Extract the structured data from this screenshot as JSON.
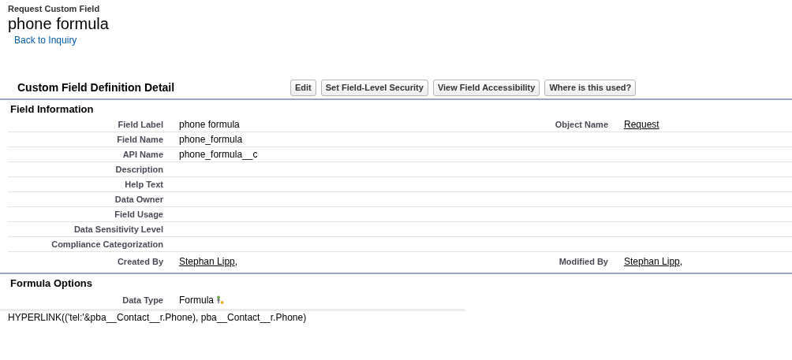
{
  "header": {
    "object": "Request Custom Field",
    "title": "phone formula",
    "back_link": "Back to Inquiry"
  },
  "detail": {
    "title": "Custom Field Definition Detail",
    "buttons": [
      "Edit",
      "Set Field-Level Security",
      "View Field Accessibility",
      "Where is this used?"
    ]
  },
  "field_information": {
    "title": "Field Information",
    "rows": [
      {
        "label": "Field Label",
        "value": "phone formula",
        "kind": "text",
        "right": {
          "label": "Object Name",
          "value": "Request",
          "kind": "link"
        }
      },
      {
        "label": "Field Name",
        "value": "phone_formula",
        "kind": "text"
      },
      {
        "label": "API Name",
        "value": "phone_formula__c",
        "kind": "text"
      },
      {
        "label": "Description"
      },
      {
        "label": "Help Text"
      },
      {
        "label": "Data Owner"
      },
      {
        "label": "Field Usage"
      },
      {
        "label": "Data Sensitivity Level"
      },
      {
        "label": "Compliance Categorization"
      },
      {
        "label": "Created By",
        "value": "Stephan Lipp",
        "kind": "link",
        "suffix": ",",
        "right": {
          "label": "Modified By",
          "value": "Stephan Lipp",
          "kind": "link",
          "suffix": ","
        }
      }
    ]
  },
  "formula_options": {
    "title": "Formula Options",
    "data_type_label": "Data Type",
    "data_type": "Formula",
    "formula": "HYPERLINK(('tel:'&pba__Contact__r.Phone), pba__Contact__r.Phone)"
  }
}
